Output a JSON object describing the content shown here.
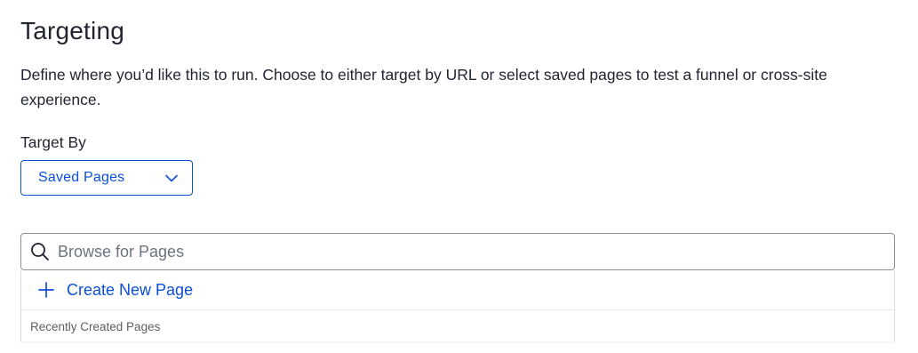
{
  "section": {
    "title": "Targeting",
    "description": "Define where you’d like this to run. Choose to either target by URL or select saved pages to test a funnel or cross-site experience."
  },
  "target_by": {
    "label": "Target By",
    "selected": "Saved Pages",
    "chevron_icon": "chevron-down-icon"
  },
  "page_browser": {
    "search_placeholder": "Browse for Pages",
    "search_value": "",
    "search_icon": "search-icon",
    "create_label": "Create New Page",
    "create_icon": "plus-icon",
    "recent_header": "Recently Created Pages"
  },
  "colors": {
    "accent": "#0b4fd8",
    "text": "#1f2430",
    "muted": "#5a5f69",
    "border": "#8a8f99"
  }
}
